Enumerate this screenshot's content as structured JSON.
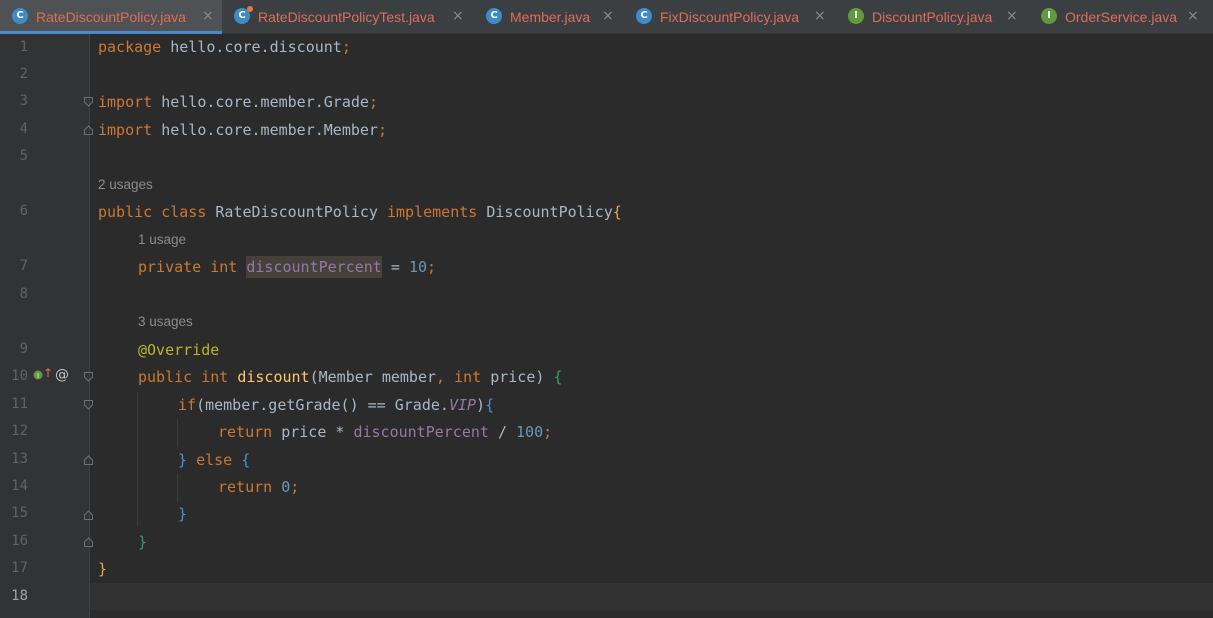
{
  "tabs": [
    {
      "label": "RateDiscountPolicy.java",
      "icon": "class-icon",
      "active": true,
      "color": "#e06c5a"
    },
    {
      "label": "RateDiscountPolicyTest.java",
      "icon": "test-class-icon",
      "active": false,
      "color": "#e06c5a"
    },
    {
      "label": "Member.java",
      "icon": "class-icon",
      "active": false,
      "color": "#e06c5a"
    },
    {
      "label": "FixDiscountPolicy.java",
      "icon": "class-icon",
      "active": false,
      "color": "#e06c5a"
    },
    {
      "label": "DiscountPolicy.java",
      "icon": "interface-icon",
      "active": false,
      "color": "#e06c5a"
    },
    {
      "label": "OrderService.java",
      "icon": "interface-icon",
      "active": false,
      "color": "#e06c5a"
    }
  ],
  "tab_icon_letters": {
    "class": "C",
    "interface": "I"
  },
  "close_glyph": "×",
  "line_numbers": [
    "1",
    "2",
    "3",
    "4",
    "5",
    "6",
    "7",
    "8",
    "9",
    "10",
    "11",
    "12",
    "13",
    "14",
    "15",
    "16",
    "17",
    "18"
  ],
  "current_line": "18",
  "hints": {
    "class_usages": "2 usages",
    "field_usages": "1 usage",
    "method_usages": "3 usages"
  },
  "gutter": {
    "override_icon_text": "↑",
    "at_icon_text": "@"
  },
  "code": {
    "l1_kw": "package",
    "l1_rest": " hello.core.discount",
    "semi": ";",
    "l3_kw": "import",
    "l3_rest": " hello.core.member.Grade",
    "l4_kw": "import",
    "l4_rest": " hello.core.member.Member",
    "l6_kw1": "public",
    "l6_kw2": "class",
    "l6_name": " RateDiscountPolicy ",
    "l6_kw3": "implements",
    "l6_iface": " DiscountPolicy",
    "brace_open": "{",
    "brace_close": "}",
    "l7_kw1": "private",
    "l7_kw2": "int",
    "l7_field": "discountPercent",
    "l7_eq": " = ",
    "l7_num": "10",
    "l9_ann": "@Override",
    "l10_kw1": "public",
    "l10_kw2": "int",
    "l10_method": "discount",
    "l10_p1": "(Member member",
    "comma": ", ",
    "l10_kw3": "int",
    "l10_p2": " price) ",
    "l11_kw": "if",
    "l11_mid": "(member.getGrade() == Grade.",
    "l11_const": "VIP",
    "l11_close": ")",
    "l12_kw": "return",
    "l12_mid": " price * ",
    "l12_field": "discountPercent",
    "l12_div": " / ",
    "l12_num": "100",
    "l13_kw": "else",
    "l14_kw": "return",
    "l14_num": "0"
  }
}
